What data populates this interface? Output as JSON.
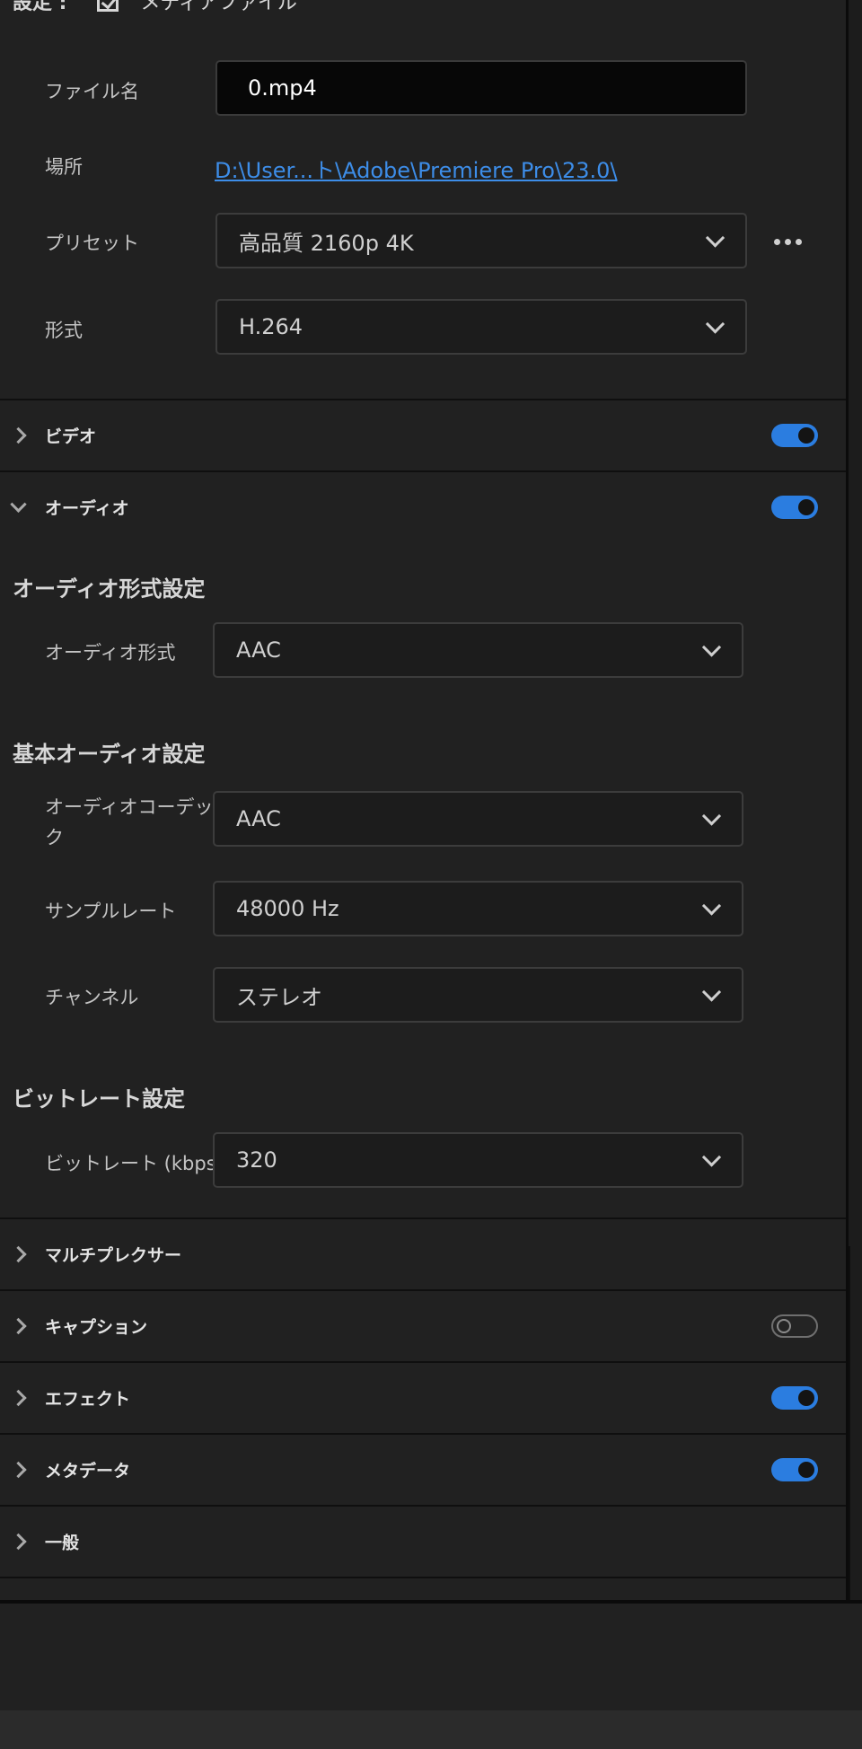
{
  "header": {
    "settings_label": "設定 :",
    "checkbox_label": "メディアファイル"
  },
  "output": {
    "filename_label": "ファイル名",
    "filename_value": "0.mp4",
    "location_label": "場所",
    "location_value": "D:\\User...ト\\Adobe\\Premiere Pro\\23.0\\",
    "preset_label": "プリセット",
    "preset_value": "高品質 2160p 4K",
    "format_label": "形式",
    "format_value": "H.264"
  },
  "sections": {
    "video": {
      "label": "ビデオ",
      "enabled": true
    },
    "audio": {
      "label": "オーディオ",
      "enabled": true
    },
    "multiplexer": {
      "label": "マルチプレクサー"
    },
    "captions": {
      "label": "キャプション",
      "enabled": false
    },
    "effects": {
      "label": "エフェクト",
      "enabled": true
    },
    "metadata": {
      "label": "メタデータ",
      "enabled": true
    },
    "general": {
      "label": "一般"
    }
  },
  "audio": {
    "format_heading": "オーディオ形式設定",
    "format_label": "オーディオ形式",
    "format_value": "AAC",
    "basic_heading": "基本オーディオ設定",
    "codec_label_line1": "オーディオコーデッ",
    "codec_label_line2": "ク",
    "codec_value": "AAC",
    "samplerate_label": "サンプルレート",
    "samplerate_value": "48000 Hz",
    "channels_label": "チャンネル",
    "channels_value": "ステレオ",
    "bitrate_heading": "ビットレート設定",
    "bitrate_label": "ビットレート (kbps)",
    "bitrate_value": "320"
  },
  "colors": {
    "accent": "#2b7de0",
    "link": "#3d8de8",
    "background": "#212121"
  }
}
